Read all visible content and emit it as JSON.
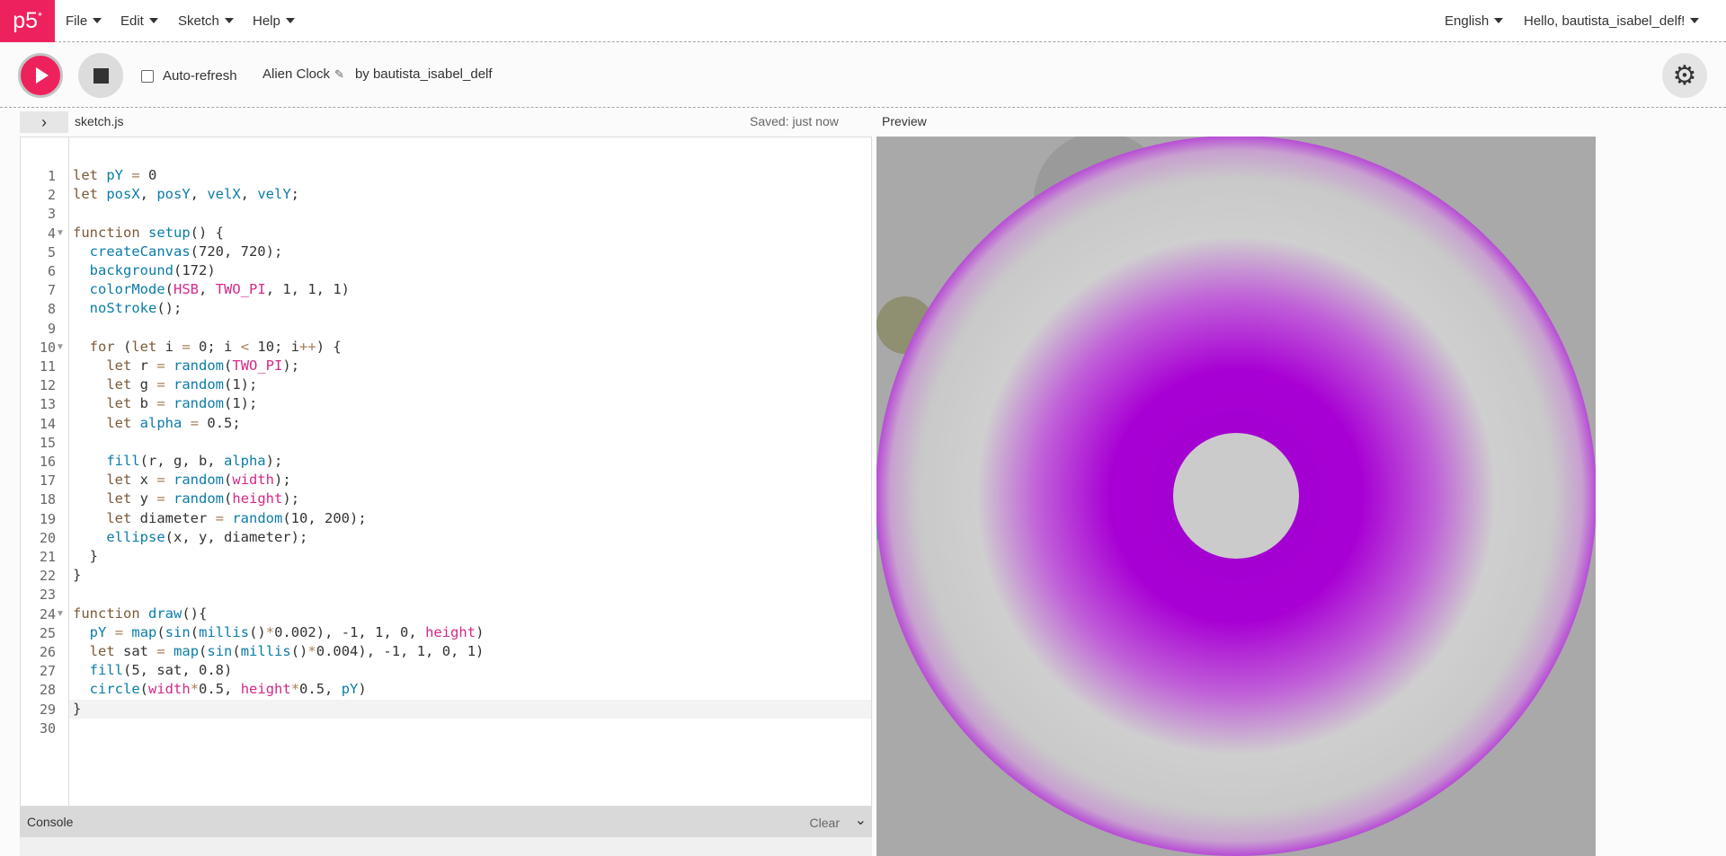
{
  "nav": {
    "logo": "p5",
    "logo_sup": "*",
    "menus": [
      "File",
      "Edit",
      "Sketch",
      "Help"
    ],
    "language": "English",
    "greeting": "Hello, bautista_isabel_delf!"
  },
  "toolbar": {
    "auto_refresh_label": "Auto-refresh",
    "auto_refresh_checked": false,
    "sketch_name": "Alien Clock",
    "author": "by bautista_isabel_delf"
  },
  "editor": {
    "file_name": "sketch.js",
    "saved_status": "Saved: just now",
    "active_line": 29,
    "lines": [
      "let pY = 0",
      "let posX, posY, velX, velY;",
      "",
      "function setup() {",
      "  createCanvas(720, 720);",
      "  background(172)",
      "  colorMode(HSB, TWO_PI, 1, 1, 1)",
      "  noStroke();",
      "",
      "  for (let i = 0; i < 10; i++) {",
      "    let r = random(TWO_PI);",
      "    let g = random(1);",
      "    let b = random(1);",
      "    let alpha = 0.5;",
      "",
      "    fill(r, g, b, alpha);",
      "    let x = random(width);",
      "    let y = random(height);",
      "    let diameter = random(10, 200);",
      "    ellipse(x, y, diameter);",
      "  }",
      "}",
      "",
      "function draw(){",
      "  pY = map(sin(millis()*0.002), -1, 1, 0, height)",
      "  let sat = map(sin(millis()*0.004), -1, 1, 0, 1)",
      "  fill(5, sat, 0.8)",
      "  circle(width*0.5, height*0.5, pY)",
      "}",
      ""
    ],
    "fold_lines": [
      4,
      10,
      24
    ]
  },
  "preview": {
    "label": "Preview",
    "background": "#a9a9a9",
    "ring_color": "#a000d0"
  },
  "console": {
    "label": "Console",
    "clear_label": "Clear"
  },
  "colors": {
    "accent": "#ed225d"
  }
}
